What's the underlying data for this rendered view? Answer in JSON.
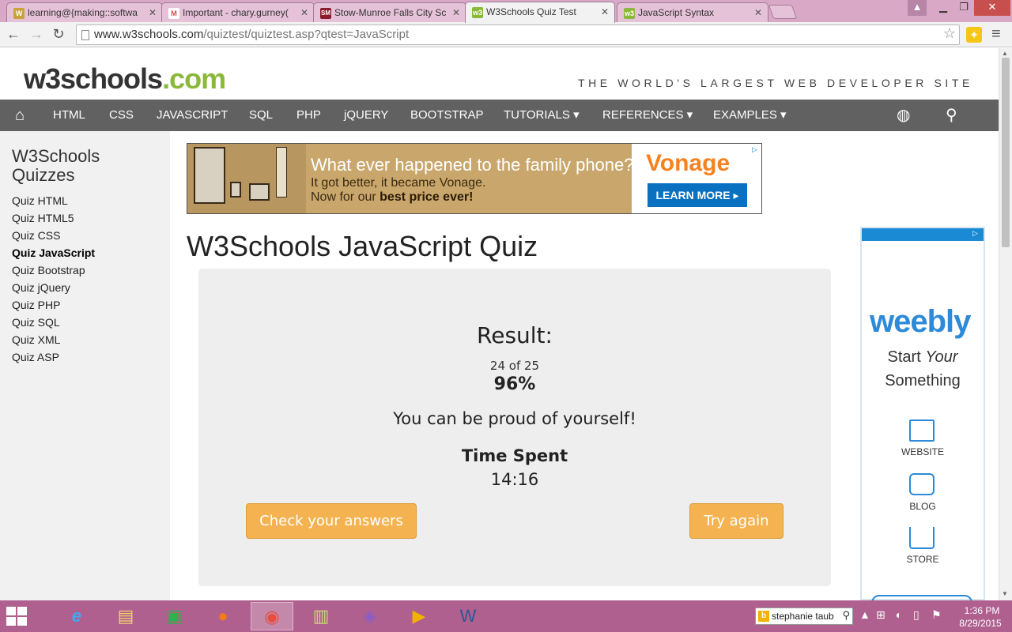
{
  "browser": {
    "tabs": [
      {
        "label": "learning@{making::softwa",
        "favicon": "W"
      },
      {
        "label": "Important - chary.gurney(",
        "favicon": "M"
      },
      {
        "label": "Stow-Munroe Falls City Sc",
        "favicon": "SM"
      },
      {
        "label": "W3Schools Quiz Test",
        "favicon": "w3"
      },
      {
        "label": "JavaScript Syntax",
        "favicon": "w3"
      }
    ],
    "url_domain": "www.w3schools.com",
    "url_path": "/quiztest/quiztest.asp?qtest=JavaScript"
  },
  "header": {
    "logo_main": "w3schools",
    "logo_tld": ".com",
    "tagline": "THE WORLD'S LARGEST WEB DEVELOPER SITE"
  },
  "nav": {
    "items": [
      "HTML",
      "CSS",
      "JAVASCRIPT",
      "SQL",
      "PHP",
      "jQUERY",
      "BOOTSTRAP",
      "TUTORIALS ▾",
      "REFERENCES ▾",
      "EXAMPLES ▾"
    ]
  },
  "sidebar": {
    "title": "W3Schools Quizzes",
    "items": [
      "Quiz HTML",
      "Quiz HTML5",
      "Quiz CSS",
      "Quiz JavaScript",
      "Quiz Bootstrap",
      "Quiz jQuery",
      "Quiz PHP",
      "Quiz SQL",
      "Quiz XML",
      "Quiz ASP"
    ],
    "active_index": 3
  },
  "ad_banner": {
    "headline": "What ever happened to the family phone?",
    "line1": "It got better,  it became Vonage.",
    "line2_prefix": "Now for our ",
    "line2_bold": "best price ever!",
    "brand": "Vonage",
    "cta": "LEARN MORE ▸"
  },
  "ad_side": {
    "brand": "weebly",
    "start": "Start ",
    "your": "Your",
    "something": "Something",
    "links": [
      "WEBSITE",
      "BLOG",
      "STORE"
    ]
  },
  "quiz": {
    "title": "W3Schools JavaScript Quiz",
    "result_heading": "Result:",
    "score": "24 of 25",
    "percent": "96%",
    "message": "You can be proud of yourself!",
    "time_label": "Time Spent",
    "time_value": "14:16",
    "check_button": "Check your answers",
    "retry_button": "Try again"
  },
  "taskbar": {
    "search_text": "stephanie taub",
    "time": "1:36 PM",
    "date": "8/29/2015"
  }
}
